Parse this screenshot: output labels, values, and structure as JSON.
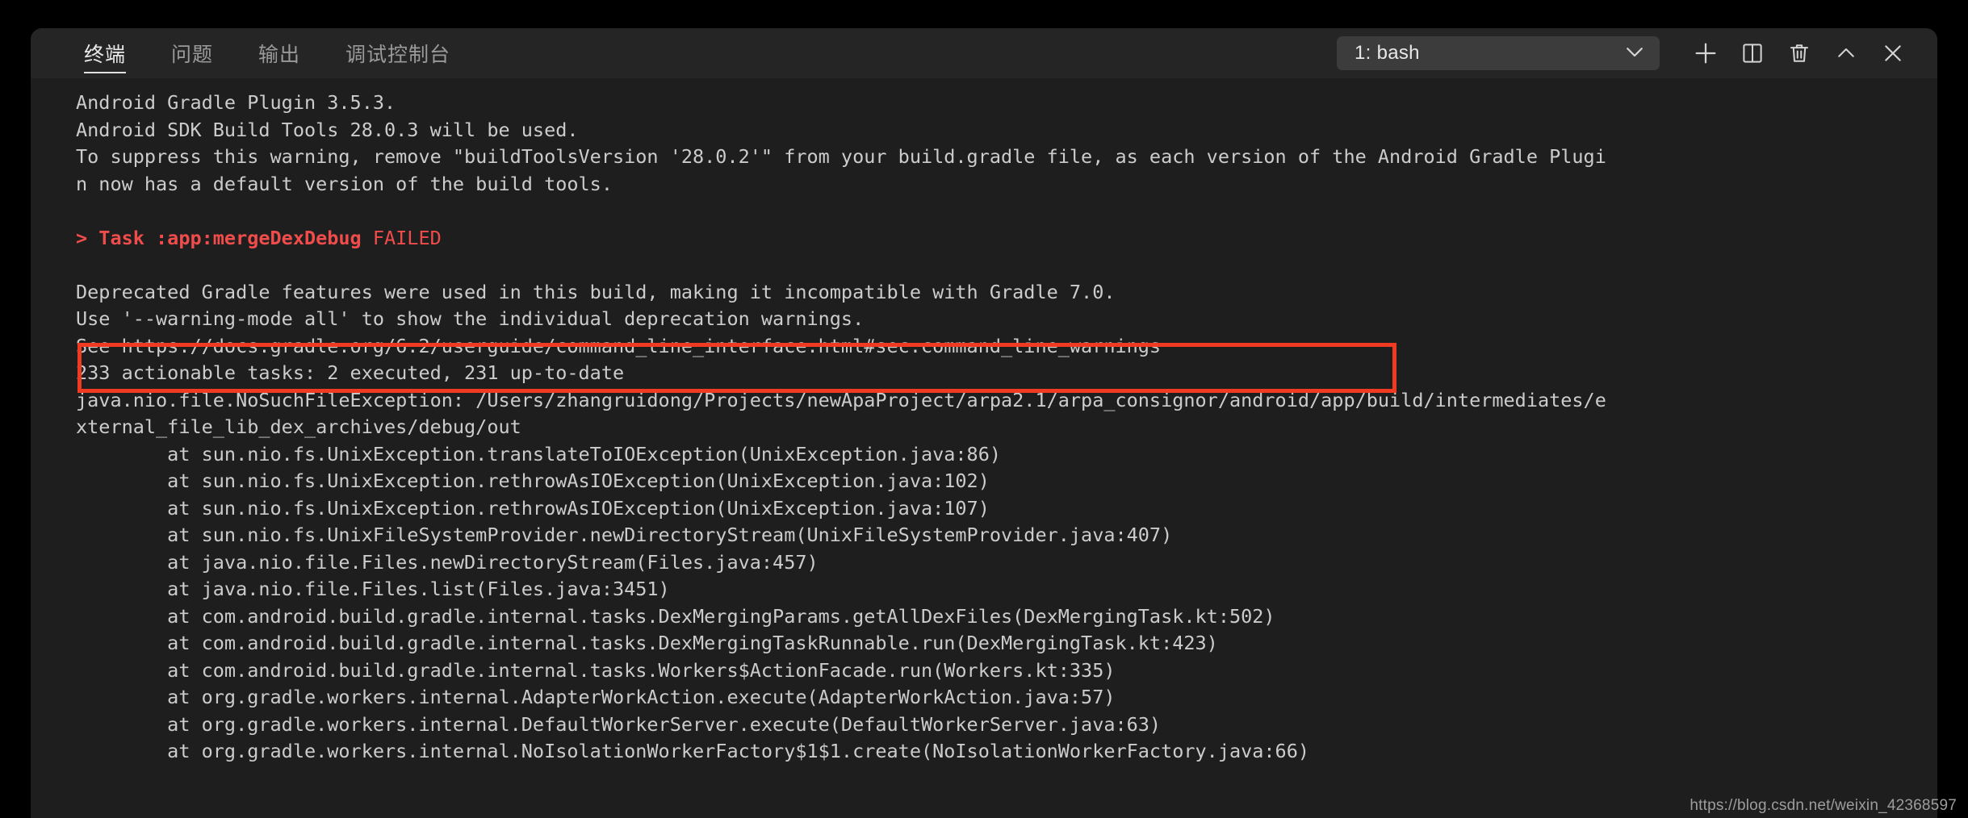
{
  "panel": {
    "tabs": [
      {
        "label": "终端",
        "name": "tab-terminal",
        "active": true
      },
      {
        "label": "问题",
        "name": "tab-problems",
        "active": false
      },
      {
        "label": "输出",
        "name": "tab-output",
        "active": false
      },
      {
        "label": "调试控制台",
        "name": "tab-debug-console",
        "active": false
      }
    ],
    "terminal_select": {
      "value": "1: bash",
      "chevron": "chevron-down-icon"
    },
    "actions": [
      {
        "name": "new-terminal-button",
        "icon": "plus-icon",
        "title": "新建终端"
      },
      {
        "name": "split-terminal-button",
        "icon": "split-icon",
        "title": "拆分终端"
      },
      {
        "name": "kill-terminal-button",
        "icon": "trash-icon",
        "title": "终止终端"
      },
      {
        "name": "maximize-panel-button",
        "icon": "chevron-up-icon",
        "title": "最大化面板"
      },
      {
        "name": "close-panel-button",
        "icon": "close-icon",
        "title": "关闭面板"
      }
    ]
  },
  "colors": {
    "panel_background": "#1e1e1e",
    "header_background": "#252526",
    "text": "#cccccc",
    "error_red": "#f14c4c",
    "highlight_box": "#f03b22",
    "select_background": "#3c3c3c",
    "page_background": "#000000"
  },
  "terminal": {
    "lines": [
      {
        "text": "Android Gradle Plugin 3.5.3.",
        "style": "normal"
      },
      {
        "text": "Android SDK Build Tools 28.0.3 will be used.",
        "style": "normal"
      },
      {
        "text": "To suppress this warning, remove \"buildToolsVersion '28.0.2'\" from your build.gradle file, as each version of the Android Gradle Plugi",
        "style": "normal"
      },
      {
        "text": "n now has a default version of the build tools.",
        "style": "normal"
      },
      {
        "text": "",
        "style": "normal"
      },
      {
        "text": "> Task :app:mergeDexDebug",
        "suffix": " FAILED",
        "style": "error-task"
      },
      {
        "text": "",
        "style": "normal"
      },
      {
        "text": "Deprecated Gradle features were used in this build, making it incompatible with Gradle 7.0.",
        "style": "normal"
      },
      {
        "text": "Use '--warning-mode all' to show the individual deprecation warnings.",
        "style": "normal"
      },
      {
        "text": "See https://docs.gradle.org/6.2/userguide/command_line_interface.html#sec:command_line_warnings",
        "style": "normal"
      },
      {
        "text": "233 actionable tasks: 2 executed, 231 up-to-date",
        "style": "normal"
      },
      {
        "text": "java.nio.file.NoSuchFileException: /Users/zhangruidong/Projects/newApaProject/arpa2.1/arpa_consignor/android/app/build/intermediates/e",
        "style": "normal"
      },
      {
        "text": "xternal_file_lib_dex_archives/debug/out",
        "style": "normal"
      },
      {
        "text": "        at sun.nio.fs.UnixException.translateToIOException(UnixException.java:86)",
        "style": "normal"
      },
      {
        "text": "        at sun.nio.fs.UnixException.rethrowAsIOException(UnixException.java:102)",
        "style": "normal"
      },
      {
        "text": "        at sun.nio.fs.UnixException.rethrowAsIOException(UnixException.java:107)",
        "style": "normal"
      },
      {
        "text": "        at sun.nio.fs.UnixFileSystemProvider.newDirectoryStream(UnixFileSystemProvider.java:407)",
        "style": "normal"
      },
      {
        "text": "        at java.nio.file.Files.newDirectoryStream(Files.java:457)",
        "style": "normal"
      },
      {
        "text": "        at java.nio.file.Files.list(Files.java:3451)",
        "style": "normal"
      },
      {
        "text": "        at com.android.build.gradle.internal.tasks.DexMergingParams.getAllDexFiles(DexMergingTask.kt:502)",
        "style": "normal"
      },
      {
        "text": "        at com.android.build.gradle.internal.tasks.DexMergingTaskRunnable.run(DexMergingTask.kt:423)",
        "style": "normal"
      },
      {
        "text": "        at com.android.build.gradle.internal.tasks.Workers$ActionFacade.run(Workers.kt:335)",
        "style": "normal"
      },
      {
        "text": "        at org.gradle.workers.internal.AdapterWorkAction.execute(AdapterWorkAction.java:57)",
        "style": "normal"
      },
      {
        "text": "        at org.gradle.workers.internal.DefaultWorkerServer.execute(DefaultWorkerServer.java:63)",
        "style": "normal"
      },
      {
        "text": "        at org.gradle.workers.internal.NoIsolationWorkerFactory$1$1.create(NoIsolationWorkerFactory.java:66)",
        "style": "normal"
      }
    ],
    "highlighted_line_index": 7,
    "highlight_note": "Deprecated Gradle features were used in this build, making it incompatible with Gradle 7.0."
  },
  "watermark": {
    "text": "https://blog.csdn.net/weixin_42368597"
  }
}
